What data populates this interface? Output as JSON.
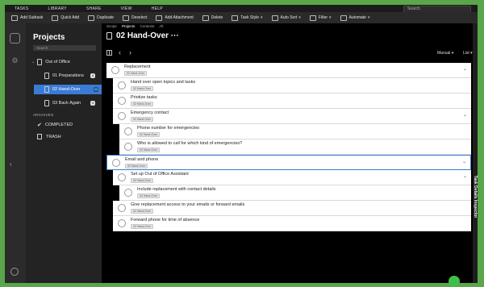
{
  "menu": [
    "TASKS",
    "LIBRARY",
    "SHARE",
    "VIEW",
    "HELP"
  ],
  "search_placeholder": "Search",
  "toolbar": [
    {
      "label": "Add Subtask",
      "caret": false
    },
    {
      "label": "Quick Add",
      "caret": false
    },
    {
      "label": "Duplicate",
      "caret": false
    },
    {
      "label": "Deselect",
      "caret": false
    },
    {
      "label": "Add Attachment",
      "caret": false
    },
    {
      "label": "Delete",
      "caret": false
    },
    {
      "label": "Task Style",
      "caret": true
    },
    {
      "label": "Auto Sort",
      "caret": true
    },
    {
      "label": "Filter",
      "caret": true
    },
    {
      "label": "Automate",
      "caret": true
    }
  ],
  "sidebar": {
    "title": "Projects",
    "search_placeholder": "Search",
    "items": [
      {
        "label": "Out of Office",
        "badge": ""
      },
      {
        "label": "01 Preparations",
        "badge": "4"
      },
      {
        "label": "02 Hand-Over",
        "badge": "11"
      },
      {
        "label": "03 Back Again",
        "badge": "4"
      }
    ],
    "archives_label": "ARCHIVES",
    "completed_label": "COMPLETED",
    "trash_label": "TRASH"
  },
  "breadcrumb": [
    "Scope",
    "Projects",
    "Contexts",
    "All"
  ],
  "page_title": "02 Hand-Over ···",
  "view": {
    "mode": "Manual",
    "layout": "List"
  },
  "tasks": [
    {
      "name": "Replacement",
      "tag": "02 Hand-Over",
      "chevron": "⌄"
    },
    {
      "name": "Hand over open topics and tasks",
      "tag": "02 Hand-Over",
      "chevron": ""
    },
    {
      "name": "Priotize tasks",
      "tag": "02 Hand-Over",
      "chevron": ""
    },
    {
      "name": "Emergency contact",
      "tag": "02 Hand-Over",
      "chevron": "⌄"
    },
    {
      "name": "Phone number for emergencies",
      "tag": "02 Hand-Over",
      "chevron": ""
    },
    {
      "name": "Who is allowed to call for which kind of emergencies?",
      "tag": "02 Hand-Over",
      "chevron": ""
    },
    {
      "name": "Email and phone",
      "tag": "02 Hand-Over",
      "chevron": "⌄"
    },
    {
      "name": "Set up Out of Office Assistant",
      "tag": "02 Hand-Over",
      "chevron": "⌄"
    },
    {
      "name": "Include replacement with contact details",
      "tag": "02 Hand-Over",
      "chevron": ""
    },
    {
      "name": "Give replacement access to your emails or forward emails",
      "tag": "02 Hand-Over",
      "chevron": ""
    },
    {
      "name": "Forward phone for time of absence",
      "tag": "02 Hand-Over",
      "chevron": ""
    }
  ],
  "inspector_label": "Task Details Inspector"
}
